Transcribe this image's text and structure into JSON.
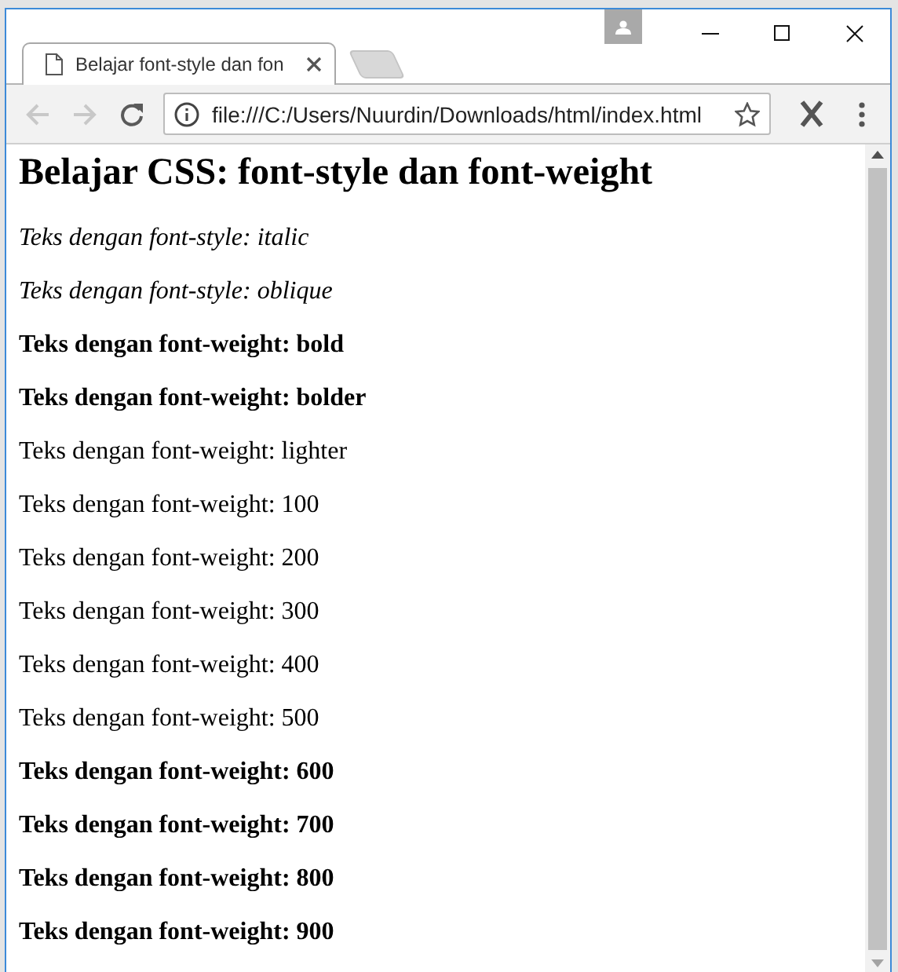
{
  "window": {
    "tabs": [
      {
        "title": "Belajar font-style dan fon",
        "selected": true
      }
    ]
  },
  "toolbar": {
    "back_disabled": true,
    "forward_disabled": true,
    "address": "file:///C:/Users/Nuurdin/Downloads/html/index.html",
    "bookmarked": false
  },
  "page": {
    "heading": "Belajar CSS: font-style dan font-weight",
    "paragraphs": [
      {
        "text": "Teks dengan font-style: italic",
        "kind": "italic"
      },
      {
        "text": "Teks dengan font-style: oblique",
        "kind": "italic"
      },
      {
        "text": "Teks dengan font-weight: bold",
        "kind": "bold"
      },
      {
        "text": "Teks dengan font-weight: bolder",
        "kind": "bold"
      },
      {
        "text": "Teks dengan font-weight: lighter",
        "kind": "plain"
      },
      {
        "text": "Teks dengan font-weight: 100",
        "kind": "plain"
      },
      {
        "text": "Teks dengan font-weight: 200",
        "kind": "plain"
      },
      {
        "text": "Teks dengan font-weight: 300",
        "kind": "plain"
      },
      {
        "text": "Teks dengan font-weight: 400",
        "kind": "plain"
      },
      {
        "text": "Teks dengan font-weight: 500",
        "kind": "plain"
      },
      {
        "text": "Teks dengan font-weight: 600",
        "kind": "bold"
      },
      {
        "text": "Teks dengan font-weight: 700",
        "kind": "bold"
      },
      {
        "text": "Teks dengan font-weight: 800",
        "kind": "bold"
      },
      {
        "text": "Teks dengan font-weight: 900",
        "kind": "bold"
      }
    ]
  }
}
